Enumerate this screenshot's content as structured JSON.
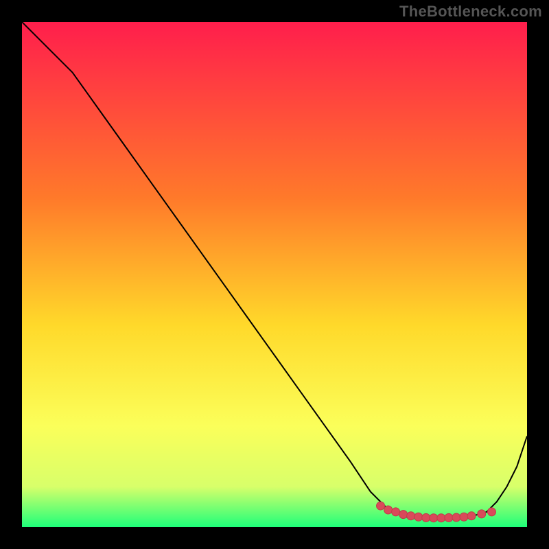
{
  "watermark": "TheBottleneck.com",
  "colors": {
    "bg": "#000000",
    "gradient_top": "#ff1e4c",
    "gradient_mid1": "#ff7a2a",
    "gradient_mid2": "#ffd92a",
    "gradient_mid3": "#fbff5a",
    "gradient_mid4": "#d8ff6a",
    "gradient_bottom": "#1eff7a",
    "line": "#000000",
    "marker_fill": "#d94a5a",
    "marker_stroke": "#c23a4a"
  },
  "chart_data": {
    "type": "line",
    "title": "",
    "xlabel": "",
    "ylabel": "",
    "xlim": [
      0,
      100
    ],
    "ylim": [
      0,
      100
    ],
    "grid": false,
    "legend": false,
    "series": [
      {
        "name": "curve",
        "x": [
          0,
          6,
          10,
          15,
          20,
          25,
          30,
          35,
          40,
          45,
          50,
          55,
          60,
          65,
          69,
          72,
          74,
          76,
          78,
          80,
          82,
          84,
          86,
          88,
          90,
          92,
          94,
          96,
          98,
          100
        ],
        "y": [
          100,
          94,
          90,
          83,
          76,
          69,
          62,
          55,
          48,
          41,
          34,
          27,
          20,
          13,
          7,
          4,
          3,
          2,
          1.8,
          1.8,
          1.8,
          1.8,
          1.9,
          2,
          2.4,
          3,
          5,
          8,
          12,
          18
        ]
      }
    ],
    "markers": {
      "name": "optimum-band",
      "x": [
        71,
        72.5,
        74,
        75.5,
        77,
        78.5,
        80,
        81.5,
        83,
        84.5,
        86,
        87.5,
        89,
        91,
        93
      ],
      "y": [
        4.2,
        3.4,
        3.0,
        2.5,
        2.2,
        2.0,
        1.85,
        1.8,
        1.8,
        1.85,
        1.9,
        2.0,
        2.2,
        2.6,
        3.0
      ]
    }
  }
}
